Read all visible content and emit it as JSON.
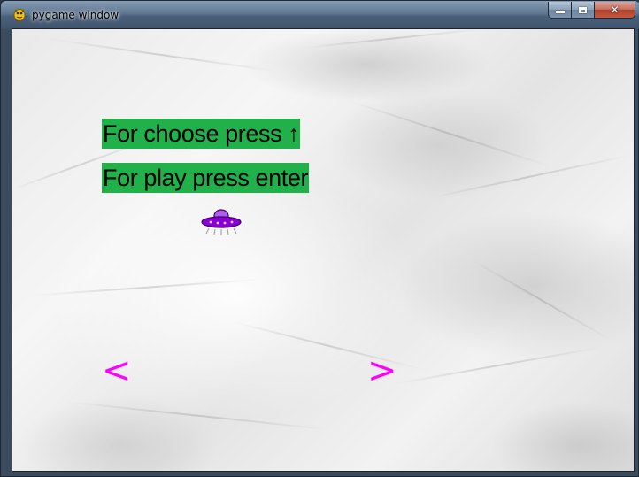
{
  "window": {
    "title": "pygame window",
    "controls": {
      "minimize_icon": "minimize-icon",
      "maximize_icon": "maximize-icon",
      "close_icon": "close-icon",
      "close_glyph": "✕"
    }
  },
  "game": {
    "line1": "For choose press ↑",
    "line2": "For play press enter",
    "prev_arrow": "<",
    "next_arrow": ">",
    "sprite": "ufo-icon",
    "colors": {
      "highlight": "#22b04a",
      "arrow": "#ff00ff",
      "ufo": "#8a00d4"
    }
  }
}
